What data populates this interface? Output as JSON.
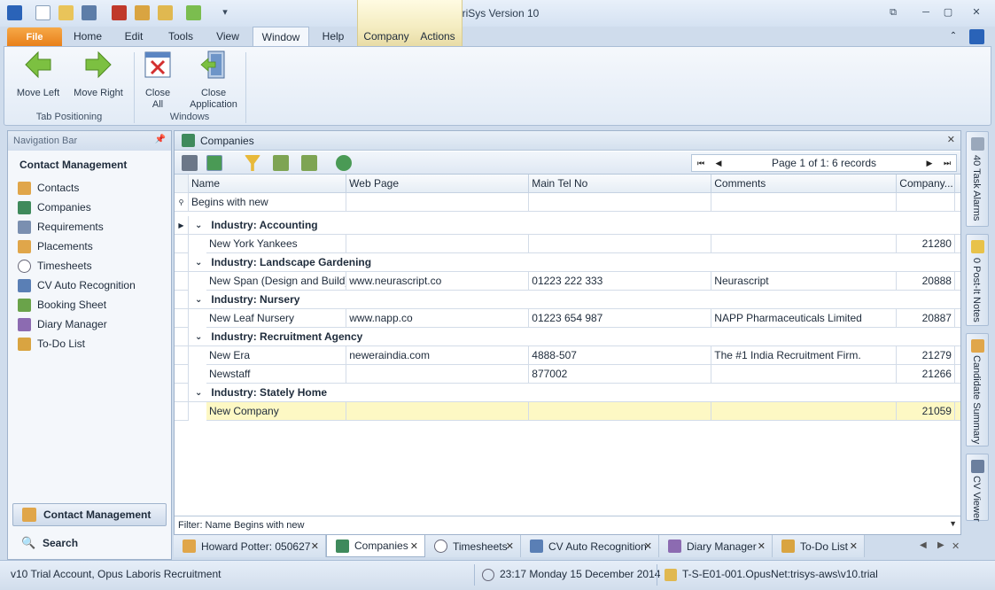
{
  "app": {
    "title": "TriSys Version 10"
  },
  "ribbon_tabs": [
    {
      "label": "File"
    },
    {
      "label": "Home"
    },
    {
      "label": "Edit"
    },
    {
      "label": "Tools"
    },
    {
      "label": "View"
    },
    {
      "label": "Window"
    },
    {
      "label": "Help"
    },
    {
      "label": "Company"
    },
    {
      "label": "Actions"
    }
  ],
  "ribbon": {
    "move_left": "Move Left",
    "move_right": "Move Right",
    "close_all_1": "Close",
    "close_all_2": "All",
    "close_app_1": "Close",
    "close_app_2": "Application",
    "group_tab_positioning": "Tab Positioning",
    "group_windows": "Windows"
  },
  "nav": {
    "header": "Navigation Bar",
    "section": "Contact Management",
    "items": [
      {
        "label": "Contacts"
      },
      {
        "label": "Companies"
      },
      {
        "label": "Requirements"
      },
      {
        "label": "Placements"
      },
      {
        "label": "Timesheets"
      },
      {
        "label": "CV Auto Recognition"
      },
      {
        "label": "Booking Sheet"
      },
      {
        "label": "Diary Manager"
      },
      {
        "label": "To-Do List"
      }
    ],
    "bottom_contact": "Contact Management",
    "bottom_search": "Search"
  },
  "panel": {
    "title": "Companies",
    "pager": "Page 1 of 1: 6 records",
    "columns": [
      "Name",
      "Web Page",
      "Main Tel No",
      "Comments",
      "Company..."
    ],
    "filter_row_value": "Begins with new",
    "groups": [
      {
        "label": "Industry: Accounting",
        "rows": [
          {
            "name": "New York Yankees",
            "web": "",
            "tel": "",
            "comments": "",
            "id": "21280"
          }
        ]
      },
      {
        "label": "Industry: Landscape Gardening",
        "rows": [
          {
            "name": "New Span (Design and Build) ...",
            "web": "www.neurascript.co",
            "tel": "01223 222 333",
            "comments": "Neurascript",
            "id": "20888"
          }
        ]
      },
      {
        "label": "Industry: Nursery",
        "rows": [
          {
            "name": "New Leaf Nursery",
            "web": "www.napp.co",
            "tel": "01223 654 987",
            "comments": "NAPP Pharmaceuticals Limited",
            "id": "20887"
          }
        ]
      },
      {
        "label": "Industry: Recruitment Agency",
        "rows": [
          {
            "name": "New Era",
            "web": "neweraindia.com",
            "tel": "4888-507",
            "comments": "The #1 India Recruitment Firm.",
            "id": "21279"
          },
          {
            "name": "Newstaff",
            "web": "",
            "tel": "877002",
            "comments": "",
            "id": "21266"
          }
        ]
      },
      {
        "label": "Industry: Stately Home",
        "rows": [
          {
            "name": "New Company",
            "web": "",
            "tel": "",
            "comments": "",
            "id": "21059"
          }
        ]
      }
    ],
    "filter_bar": "Filter: Name Begins with new"
  },
  "right_panels": [
    {
      "label": "40 Task Alarms"
    },
    {
      "label": "0 Post-It Notes"
    },
    {
      "label": "Candidate Summary"
    },
    {
      "label": "CV Viewer"
    }
  ],
  "doc_tabs": [
    {
      "label": "Howard Potter: 050627"
    },
    {
      "label": "Companies"
    },
    {
      "label": "Timesheets"
    },
    {
      "label": "CV Auto Recognition"
    },
    {
      "label": "Diary Manager"
    },
    {
      "label": "To-Do List"
    }
  ],
  "status": {
    "account": "v10 Trial Account, Opus Laboris Recruitment",
    "datetime": "23:17  Monday 15 December 2014",
    "connection": "T-S-E01-001.OpusNet:trisys-aws\\v10.trial"
  },
  "colors": {
    "accent_file": "#e8801a",
    "selected_row": "#fdf8c4",
    "context_tab": "#f4ecc0"
  }
}
